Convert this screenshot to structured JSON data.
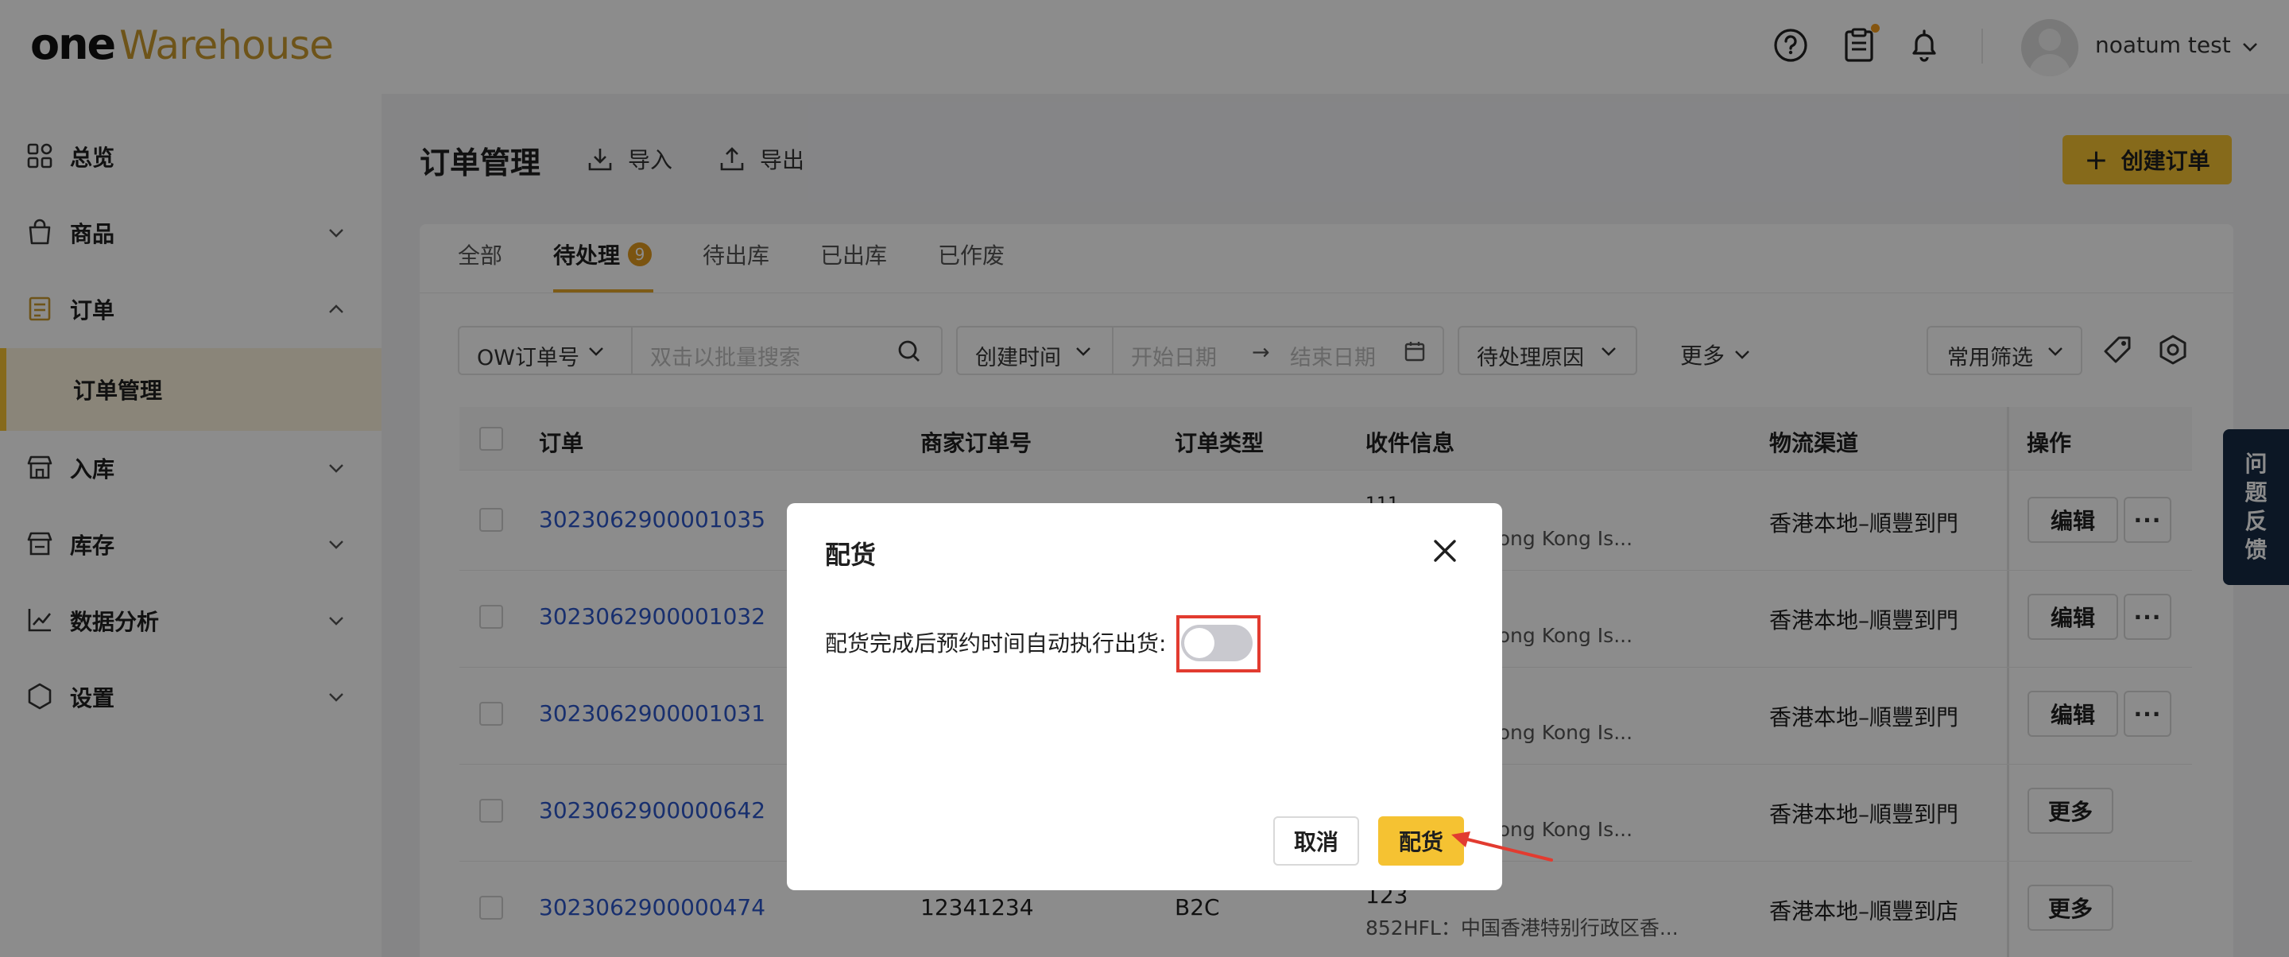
{
  "app": {
    "logo_one": "one",
    "logo_warehouse": "Warehouse",
    "user_name": "noatum test"
  },
  "sidebar": {
    "items": [
      {
        "label": "总览",
        "icon": "dashboard-icon"
      },
      {
        "label": "商品",
        "icon": "product-bag-icon"
      },
      {
        "label": "订单",
        "icon": "order-list-icon"
      },
      {
        "label": "订单管理",
        "sub": true
      },
      {
        "label": "入库",
        "icon": "inbound-store-icon"
      },
      {
        "label": "库存",
        "icon": "inventory-store-icon"
      },
      {
        "label": "数据分析",
        "icon": "analytics-chart-icon"
      },
      {
        "label": "设置",
        "icon": "settings-hex-icon"
      }
    ]
  },
  "page": {
    "title": "订单管理",
    "import_label": "导入",
    "export_label": "导出",
    "create_label": "创建订单"
  },
  "tabs": [
    {
      "label": "全部"
    },
    {
      "label": "待处理",
      "badge": "9",
      "active": true
    },
    {
      "label": "待出库"
    },
    {
      "label": "已出库"
    },
    {
      "label": "已作废"
    }
  ],
  "filters": {
    "order_type_select": "OW订单号",
    "search_placeholder": "双击以批量搜索",
    "time_select": "创建时间",
    "start_date_placeholder": "开始日期",
    "range_arrow": "→",
    "end_date_placeholder": "结束日期",
    "reason_select": "待处理原因",
    "more_label": "更多",
    "common_filter_select": "常用筛选"
  },
  "table": {
    "headers": [
      "订单",
      "商家订单号",
      "订单类型",
      "收件信息",
      "物流渠道",
      "操作"
    ],
    "rows": [
      {
        "order": "3023062900001035",
        "merchant_no": "",
        "type": "",
        "recipient_top": "111",
        "recipient_addr": "政区 Hong Kong Is...",
        "logistics": "香港本地–順豐到門",
        "actions": [
          "编辑",
          "···"
        ]
      },
      {
        "order": "3023062900001032",
        "merchant_no": "",
        "type": "",
        "recipient_top": "",
        "recipient_addr": "政区 Hong Kong Is...",
        "logistics": "香港本地–順豐到門",
        "actions": [
          "编辑",
          "···"
        ]
      },
      {
        "order": "3023062900001031",
        "merchant_no": "",
        "type": "",
        "recipient_top": "",
        "recipient_addr": "政区 Hong Kong Is...",
        "logistics": "香港本地–順豐到門",
        "actions": [
          "编辑",
          "···"
        ]
      },
      {
        "order": "3023062900000642",
        "merchant_no": "",
        "type": "",
        "recipient_top": "",
        "recipient_addr": "政区 Hong Kong Is...",
        "logistics": "香港本地–順豐到門",
        "actions": [
          "更多"
        ]
      },
      {
        "order": "3023062900000474",
        "merchant_no": "12341234",
        "type": "B2C",
        "recipient_top": "123",
        "recipient_addr": "852HFL：中国香港特别行政区香...",
        "logistics": "香港本地–順豐到店",
        "actions": [
          "更多"
        ]
      }
    ]
  },
  "feedback": {
    "label_chars": [
      "问",
      "题",
      "反",
      "馈"
    ]
  },
  "modal": {
    "title": "配货",
    "toggle_label": "配货完成后预约时间自动执行出货:",
    "toggle_on": false,
    "cancel_label": "取消",
    "confirm_label": "配货"
  },
  "colors": {
    "accent": "#f5c232",
    "brand_gold": "#c99a2e",
    "link": "#2c57c9",
    "badge": "#e09a1e",
    "highlight_frame": "#e23b30",
    "feedback_bg": "#162a44"
  }
}
